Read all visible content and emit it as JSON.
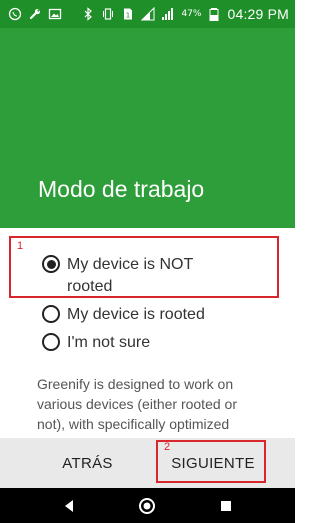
{
  "status_bar": {
    "battery_percent": "47%",
    "time": "04:29 PM",
    "icons": [
      "whatsapp-icon",
      "wrench-icon",
      "image-icon",
      "bluetooth-icon",
      "vibrate-icon",
      "sim-icon",
      "signal-icon",
      "signal-icon",
      "battery-icon"
    ]
  },
  "header": {
    "title": "Modo de trabajo",
    "background": "#2e9e3a"
  },
  "options": [
    {
      "label": "My device is NOT rooted",
      "selected": true
    },
    {
      "label": "My device is rooted",
      "selected": false
    },
    {
      "label": "I'm not sure",
      "selected": false
    }
  ],
  "description": "Greenify is designed to work on various devices (either rooted or not), with specifically optimized",
  "buttons": {
    "back": "ATRÁS",
    "next": "SIGUIENTE"
  },
  "annotations": {
    "one": "1",
    "two": "2",
    "color": "#d9262c"
  },
  "nav": {
    "icons": [
      "back-icon",
      "home-icon",
      "recents-icon"
    ]
  }
}
